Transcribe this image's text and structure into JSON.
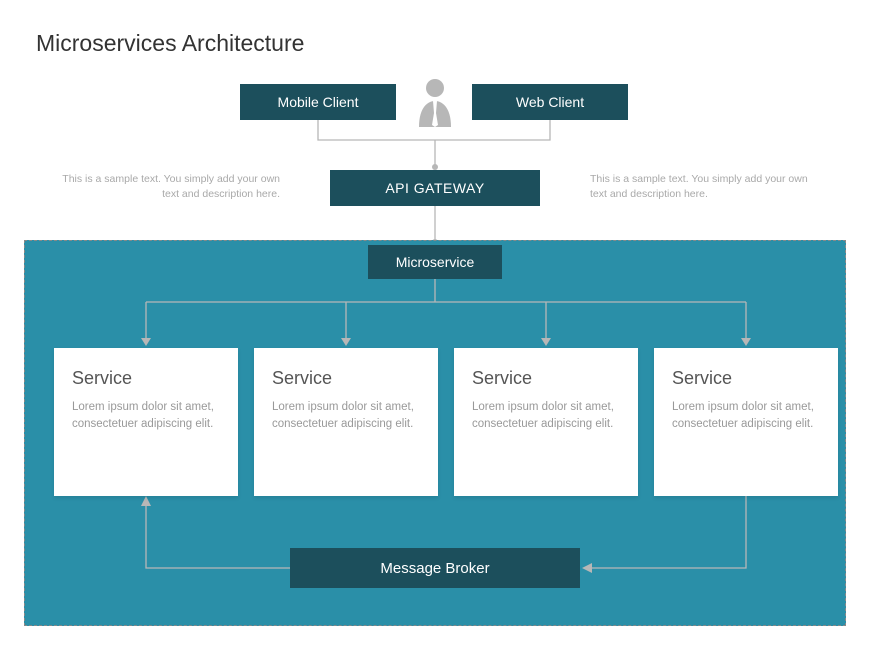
{
  "title": "Microservices Architecture",
  "clients": {
    "mobile": "Mobile Client",
    "web": "Web Client"
  },
  "gateway": "API GATEWAY",
  "sample_text": {
    "left": "This is a sample text. You simply add your own text and description here.",
    "right": "This is a sample text. You simply add your own text and description here."
  },
  "microservice": "Microservice",
  "services": [
    {
      "title": "Service",
      "body": "Lorem ipsum dolor sit amet, consectetuer adipiscing elit."
    },
    {
      "title": "Service",
      "body": "Lorem ipsum dolor sit amet, consectetuer adipiscing elit."
    },
    {
      "title": "Service",
      "body": "Lorem ipsum dolor sit amet, consectetuer adipiscing elit."
    },
    {
      "title": "Service",
      "body": "Lorem ipsum dolor sit amet, consectetuer adipiscing elit."
    }
  ],
  "message_broker": "Message Broker"
}
